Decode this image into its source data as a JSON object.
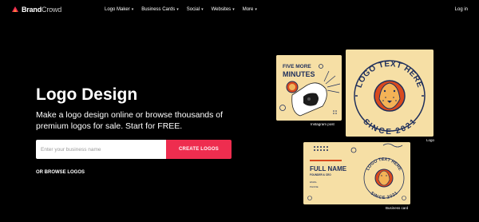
{
  "brand": {
    "name_bold": "Brand",
    "name_light": "Crowd"
  },
  "nav": {
    "items": [
      {
        "label": "Logo Maker"
      },
      {
        "label": "Business Cards"
      },
      {
        "label": "Social"
      },
      {
        "label": "Websites"
      },
      {
        "label": "More"
      }
    ],
    "login": "Log in"
  },
  "hero": {
    "title": "Logo Design",
    "subtitle": "Make a logo design online or browse thousands of premium logos for sale. Start for FREE.",
    "search_placeholder": "Enter your business name",
    "cta": "CREATE LOGOS",
    "browse": "OR BROWSE LOGOS"
  },
  "examples": {
    "instagram": {
      "line1": "FIVE MORE",
      "line2": "MINUTES",
      "caption": "Instagram post"
    },
    "logo": {
      "top_text": "LOGO TEXT HERE",
      "bottom_text": "SINCE 2021",
      "caption": "Logo"
    },
    "business_card": {
      "name": "FULL NAME",
      "role": "FOUNDER & CEO",
      "email_label": "EMAIL",
      "phone_label": "PHONE",
      "top_text": "LOGO TEXT HERE",
      "bottom_text": "SINCE 2021",
      "caption": "Business card"
    }
  },
  "colors": {
    "accent": "#ee2d4f",
    "card_bg": "#f6dfa5",
    "navy": "#1f2f5c",
    "badge_orange": "#d94a1e"
  }
}
